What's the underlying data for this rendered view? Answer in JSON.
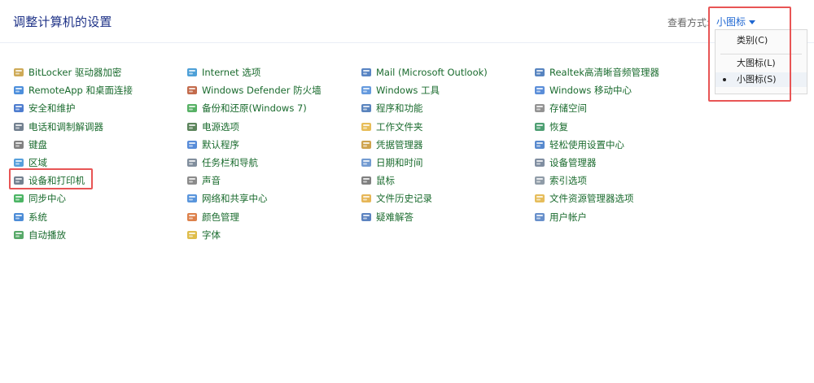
{
  "header": {
    "title": "调整计算机的设置",
    "view_by_label": "查看方式:",
    "view_by_value": "小图标"
  },
  "view_menu": {
    "items": [
      {
        "label": "类别(C)",
        "selected": false
      },
      {
        "label": "大图标(L)",
        "selected": false
      },
      {
        "label": "小图标(S)",
        "selected": true
      }
    ]
  },
  "columns": [
    {
      "items": [
        {
          "label": "BitLocker 驱动器加密",
          "icon": "bitlocker-icon",
          "color": "#c59b3a"
        },
        {
          "label": "RemoteApp 和桌面连接",
          "icon": "remoteapp-icon",
          "color": "#2e7bd6"
        },
        {
          "label": "安全和维护",
          "icon": "flag-icon",
          "color": "#2f66c7"
        },
        {
          "label": "电话和调制解调器",
          "icon": "modem-icon",
          "color": "#5a6b7d"
        },
        {
          "label": "键盘",
          "icon": "keyboard-icon",
          "color": "#6b6b6b"
        },
        {
          "label": "区域",
          "icon": "globe-clock-icon",
          "color": "#3a8fd6"
        },
        {
          "label": "设备和打印机",
          "icon": "printer-icon",
          "color": "#5a6b7d"
        },
        {
          "label": "同步中心",
          "icon": "sync-icon",
          "color": "#2da84a"
        },
        {
          "label": "系统",
          "icon": "monitor-icon",
          "color": "#2d78d0"
        },
        {
          "label": "自动播放",
          "icon": "autoplay-icon",
          "color": "#3a9a4e"
        }
      ]
    },
    {
      "items": [
        {
          "label": "Internet 选项",
          "icon": "internet-icon",
          "color": "#2f8fd0"
        },
        {
          "label": "Windows Defender 防火墙",
          "icon": "firewall-icon",
          "color": "#b8512d"
        },
        {
          "label": "备份和还原(Windows 7)",
          "icon": "backup-icon",
          "color": "#3aa34a"
        },
        {
          "label": "电源选项",
          "icon": "power-icon",
          "color": "#3e6e3e"
        },
        {
          "label": "默认程序",
          "icon": "default-programs-icon",
          "color": "#3b78d2"
        },
        {
          "label": "任务栏和导航",
          "icon": "taskbar-icon",
          "color": "#6b7a8c"
        },
        {
          "label": "声音",
          "icon": "speaker-icon",
          "color": "#777777"
        },
        {
          "label": "网络和共享中心",
          "icon": "network-icon",
          "color": "#3c82d6"
        },
        {
          "label": "颜色管理",
          "icon": "color-icon",
          "color": "#d76b2b"
        },
        {
          "label": "字体",
          "icon": "font-icon",
          "color": "#d9b12c"
        }
      ]
    },
    {
      "items": [
        {
          "label": "Mail (Microsoft Outlook)",
          "icon": "mail-icon",
          "color": "#3b6fb8"
        },
        {
          "label": "Windows 工具",
          "icon": "windows-tools-icon",
          "color": "#4a88d8"
        },
        {
          "label": "程序和功能",
          "icon": "programs-icon",
          "color": "#3d6fb2"
        },
        {
          "label": "工作文件夹",
          "icon": "work-folder-icon",
          "color": "#e3b23c"
        },
        {
          "label": "凭据管理器",
          "icon": "credential-icon",
          "color": "#c5932f"
        },
        {
          "label": "日期和时间",
          "icon": "clock-icon",
          "color": "#5b89c9"
        },
        {
          "label": "鼠标",
          "icon": "mouse-icon",
          "color": "#6a6a6a"
        },
        {
          "label": "文件历史记录",
          "icon": "file-history-icon",
          "color": "#e2a93a"
        },
        {
          "label": "疑难解答",
          "icon": "troubleshoot-icon",
          "color": "#3f6db5"
        }
      ]
    },
    {
      "items": [
        {
          "label": "Realtek高清晰音频管理器",
          "icon": "audio-manager-icon",
          "color": "#3a6fb5"
        },
        {
          "label": "Windows 移动中心",
          "icon": "mobility-icon",
          "color": "#3e7ad2"
        },
        {
          "label": "存储空间",
          "icon": "storage-icon",
          "color": "#808080"
        },
        {
          "label": "恢复",
          "icon": "recovery-icon",
          "color": "#2f8e5a"
        },
        {
          "label": "轻松使用设置中心",
          "icon": "ease-of-access-icon",
          "color": "#3a74c6"
        },
        {
          "label": "设备管理器",
          "icon": "device-manager-icon",
          "color": "#6a7a90"
        },
        {
          "label": "索引选项",
          "icon": "indexing-icon",
          "color": "#7d8b99"
        },
        {
          "label": "文件资源管理器选项",
          "icon": "folder-options-icon",
          "color": "#e2b23e"
        },
        {
          "label": "用户帐户",
          "icon": "user-accounts-icon",
          "color": "#4e7cc2"
        }
      ]
    }
  ]
}
